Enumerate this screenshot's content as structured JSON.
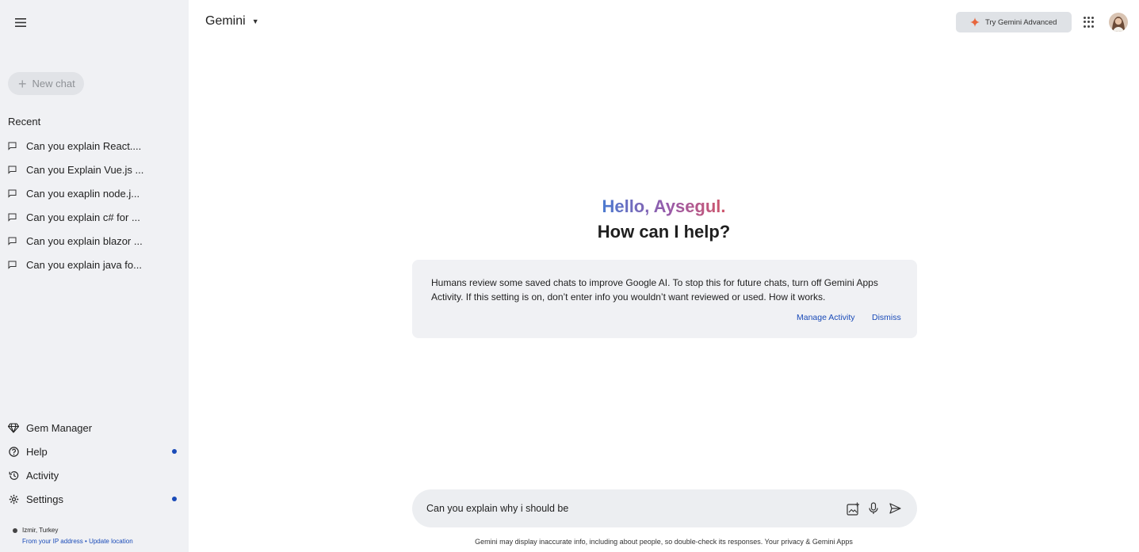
{
  "sidebar": {
    "new_chat_label": "New chat",
    "recent_title": "Recent",
    "recent_items": [
      "Can you explain React....",
      "Can you Explain Vue.js ...",
      "Can you exaplin node.j...",
      "Can you explain c# for ...",
      "Can you explain blazor ...",
      "Can you explain java fo..."
    ],
    "bottom_items": [
      {
        "label": "Gem Manager",
        "icon": "gem-icon",
        "dot": false
      },
      {
        "label": "Help",
        "icon": "help-icon",
        "dot": true
      },
      {
        "label": "Activity",
        "icon": "history-icon",
        "dot": false
      },
      {
        "label": "Settings",
        "icon": "gear-icon",
        "dot": true
      }
    ],
    "location": {
      "place": "Izmir, Turkey",
      "source": "From your IP address",
      "separator": "•",
      "update_link": "Update location"
    }
  },
  "header": {
    "model_name": "Gemini",
    "try_advanced": "Try Gemini Advanced"
  },
  "greeting": {
    "hello": "Hello, Aysegul.",
    "help": "How can I help?"
  },
  "notice": {
    "text": "Humans review some saved chats to improve Google AI. To stop this for future chats, turn off Gemini Apps Activity. If this setting is on, don’t enter info you wouldn’t want reviewed or used. How it works.",
    "manage_label": "Manage Activity",
    "dismiss_label": "Dismiss"
  },
  "prompt": {
    "value": "Can you explain why i should be"
  },
  "footer": {
    "disclaimer": "Gemini may display inaccurate info, including about people, so double-check its responses.",
    "privacy_link": "Your privacy & Gemini Apps"
  },
  "colors": {
    "sidebar_bg": "#f0f1f4",
    "link": "#1a4bb8",
    "greeting_gradient": [
      "#4c7bd0",
      "#9a5aa8",
      "#d0576b"
    ]
  }
}
